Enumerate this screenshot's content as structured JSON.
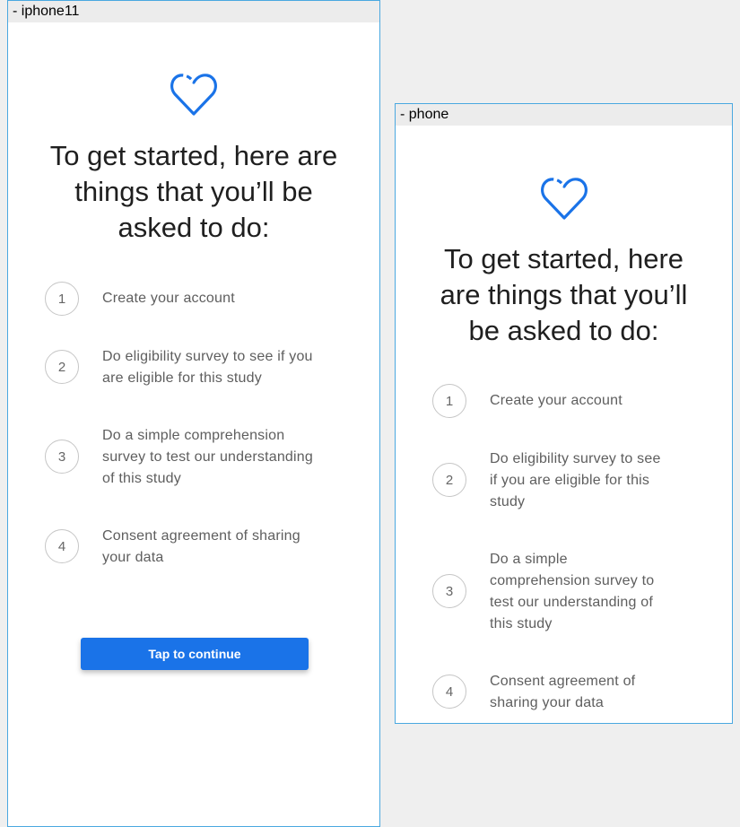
{
  "frames": [
    {
      "label": "- iphone11",
      "title_lines": [
        "To get started, here are",
        "things that you’ll be",
        "asked to do:"
      ],
      "steps": [
        {
          "number": "1",
          "lines": [
            "Create your account"
          ]
        },
        {
          "number": "2",
          "lines": [
            "Do eligibility survey to see if you",
            "are eligible for this study"
          ]
        },
        {
          "number": "3",
          "lines": [
            "Do a simple comprehension",
            "survey to test our understanding",
            "of this study"
          ]
        },
        {
          "number": "4",
          "lines": [
            "Consent agreement of sharing",
            "your data"
          ]
        }
      ],
      "button_label": "Tap to continue"
    },
    {
      "label": "- phone",
      "title_lines": [
        "To get started, here",
        "are things that you’ll",
        "be asked to do:"
      ],
      "steps": [
        {
          "number": "1",
          "lines": [
            "Create your account"
          ]
        },
        {
          "number": "2",
          "lines": [
            "Do eligibility survey to see",
            "if you are eligible for this",
            "study"
          ]
        },
        {
          "number": "3",
          "lines": [
            "Do a simple",
            "comprehension survey to",
            "test our understanding of",
            "this study"
          ]
        },
        {
          "number": "4",
          "lines": [
            "Consent agreement of",
            "sharing your data"
          ]
        }
      ]
    }
  ],
  "colors": {
    "accent": "#1a73e8",
    "frame_border": "#4aa8e0"
  },
  "icons": {
    "heart": "heart-outline-icon"
  }
}
